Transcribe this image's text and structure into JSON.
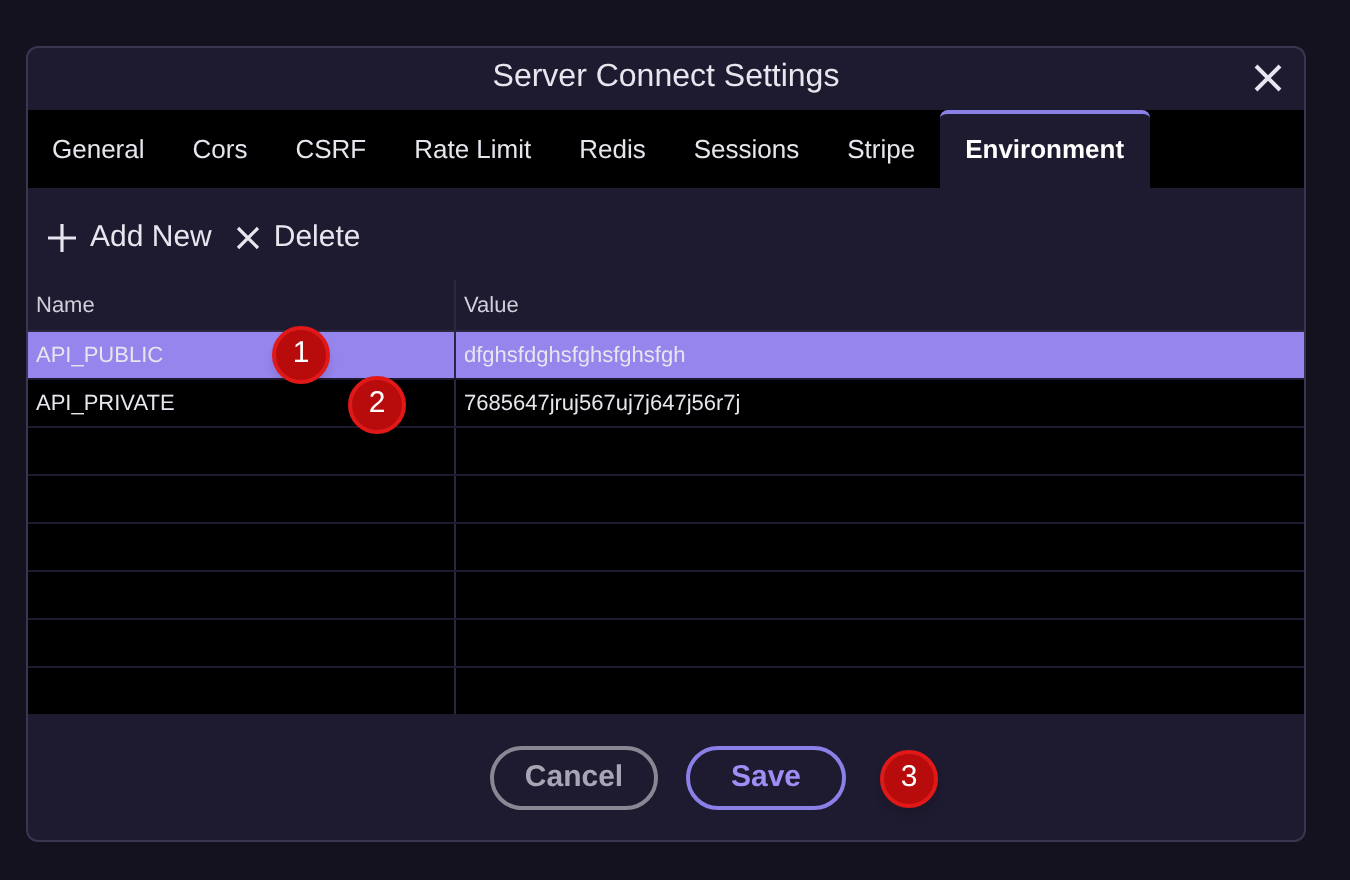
{
  "dialog": {
    "title": "Server Connect Settings"
  },
  "tabs": [
    {
      "label": "General",
      "selected": false
    },
    {
      "label": "Cors",
      "selected": false
    },
    {
      "label": "CSRF",
      "selected": false
    },
    {
      "label": "Rate Limit",
      "selected": false
    },
    {
      "label": "Redis",
      "selected": false
    },
    {
      "label": "Sessions",
      "selected": false
    },
    {
      "label": "Stripe",
      "selected": false
    },
    {
      "label": "Environment",
      "selected": true
    }
  ],
  "toolbar": [
    {
      "kind": "add",
      "label": "Add New"
    },
    {
      "kind": "delete",
      "label": "Delete"
    }
  ],
  "table": {
    "columns": [
      "Name",
      "Value"
    ],
    "rows": [
      {
        "cells": [
          "API_PUBLIC",
          "dfghsfdghsfghsfghsfgh"
        ],
        "selected": true
      },
      {
        "cells": [
          "API_PRIVATE",
          "7685647jruj567uj7j647j56r7j"
        ],
        "selected": false
      }
    ]
  },
  "buttons": [
    {
      "kind": "cancel",
      "label": "Cancel"
    },
    {
      "kind": "save",
      "label": "Save"
    }
  ],
  "annotations": [
    "1",
    "2",
    "3"
  ]
}
